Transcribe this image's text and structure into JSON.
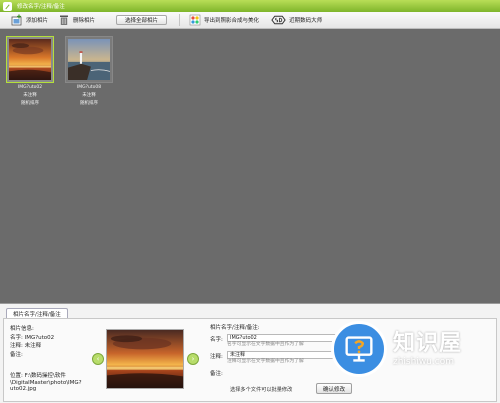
{
  "titlebar": {
    "title": "修改名字/注释/备注"
  },
  "toolbar": {
    "add_photos": "添加相片",
    "delete_photos": "删除相片",
    "select_all": "选择全部相片",
    "export_effects": "导出到照影合成与美化",
    "nearby_master": "近期数码大师"
  },
  "photos": [
    {
      "name": "IMG?uto02",
      "note_status": "未注释",
      "remark_status": "随机排序",
      "selected": true
    },
    {
      "name": "IMG?uto08",
      "note_status": "未注释",
      "remark_status": "随机排序",
      "selected": false
    }
  ],
  "panel": {
    "tab_label": "相片名字/注释/备注",
    "info_heading": "相片信息:",
    "info_name": "名字: IMG?uto02",
    "info_note": "注释: 未注释",
    "info_remark": "备注:",
    "info_location": "位置: F:\\数码操控\\软件\\DigitalMaster\\photo\\IMG?uto02.jpg",
    "edit_heading": "相片名字/注释/备注:",
    "name_label": "名字:",
    "name_value": "IMG?uto02",
    "name_hint": "名字可显示在文字数据中且作为了解",
    "note_label": "注释:",
    "note_value": "未注释",
    "note_hint": "注释可显示在文字数据中且作为了解",
    "remark_label": "备注:",
    "batch_hint": "选择多个文件可以批量修改",
    "batch_button": "确认修改"
  },
  "watermark": {
    "text_cn": "知识屋",
    "url": "zhishiwu.com"
  },
  "colors": {
    "titlebar": "#8cc63f",
    "accent": "#b4e03a",
    "gallery_bg": "#6b6b6b",
    "watermark_blue": "#3b8ee2"
  }
}
